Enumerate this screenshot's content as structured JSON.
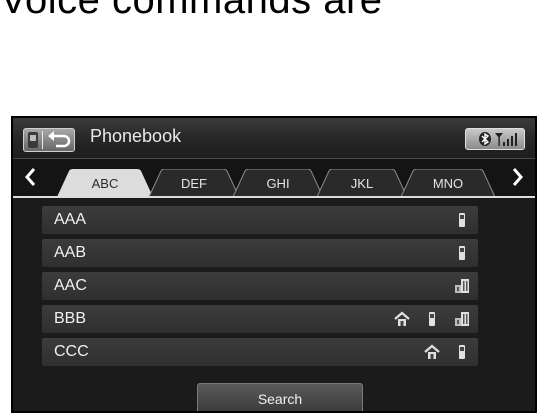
{
  "heading": "Voice commands are",
  "header": {
    "title": "Phonebook"
  },
  "tabs": [
    {
      "label": "ABC",
      "active": true
    },
    {
      "label": "DEF",
      "active": false
    },
    {
      "label": "GHI",
      "active": false
    },
    {
      "label": "JKL",
      "active": false
    },
    {
      "label": "MNO",
      "active": false
    }
  ],
  "contacts": [
    {
      "name": "AAA",
      "icons": [
        "mobile-icon"
      ]
    },
    {
      "name": "AAB",
      "icons": [
        "mobile-icon"
      ]
    },
    {
      "name": "AAC",
      "icons": [
        "office-icon"
      ]
    },
    {
      "name": "BBB",
      "icons": [
        "home-icon",
        "mobile-icon",
        "office-icon"
      ]
    },
    {
      "name": "CCC",
      "icons": [
        "home-icon",
        "mobile-icon"
      ]
    }
  ],
  "search_label": "Search",
  "colors": {
    "background": "#1b1b1b",
    "row": "#353535",
    "active_tab": "#dcdcdc",
    "text": "#f0f0f0"
  }
}
